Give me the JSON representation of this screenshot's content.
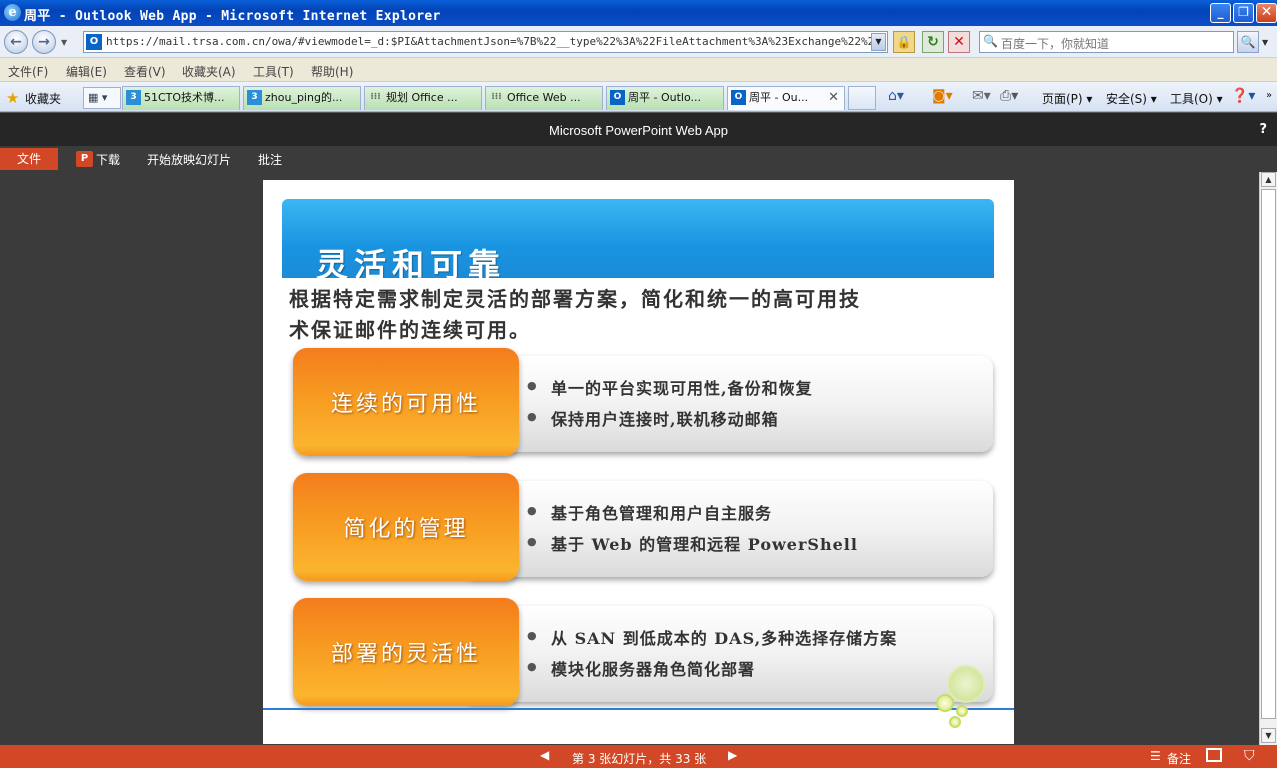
{
  "window": {
    "title": "周平 - Outlook Web App - Microsoft Internet Explorer"
  },
  "address": {
    "url": "https://mail.trsa.com.cn/owa/#viewmodel=_d:$PI&AttachmentJson=%7B%22__type%22%3A%22FileAttachment%3A%23Exchange%22%2C%22Attachm",
    "search_placeholder": "百度一下，你就知道"
  },
  "menu": [
    "文件(F)",
    "编辑(E)",
    "查看(V)",
    "收藏夹(A)",
    "工具(T)",
    "帮助(H)"
  ],
  "favorites_label": "收藏夹",
  "tabs": [
    {
      "label": "51CTO技术博...",
      "icon": "blog-icon"
    },
    {
      "label": "zhou_ping的...",
      "icon": "blog-icon"
    },
    {
      "label": "规划 Office ...",
      "icon": "office-icon"
    },
    {
      "label": "Office Web ...",
      "icon": "office-icon"
    },
    {
      "label": "周平 - Outlo...",
      "icon": "outlook-icon"
    },
    {
      "label": "周平 - Ou...",
      "icon": "outlook-icon"
    }
  ],
  "commands": {
    "page": "页面(P)",
    "safety": "安全(S)",
    "tools": "工具(O)"
  },
  "app": {
    "title": "Microsoft PowerPoint Web App",
    "help": "?"
  },
  "ribbon": {
    "file": "文件",
    "download": "下载",
    "start_slideshow": "开始放映幻灯片",
    "comments": "批注"
  },
  "slide": {
    "title": "灵活和可靠",
    "subtitle_line1": "根据特定需求制定灵活的部署方案，简化和统一的高可用技",
    "subtitle_line2": "术保证邮件的连续可用。",
    "rows": [
      {
        "label": "连续的可用性",
        "bullets": [
          "单一的平台实现可用性,备份和恢复",
          "保持用户连接时,联机移动邮箱"
        ]
      },
      {
        "label": "简化的管理",
        "bullets": [
          "基于角色管理和用户自主服务",
          "基于 Web 的管理和远程 PowerShell"
        ]
      },
      {
        "label": "部署的灵活性",
        "bullets": [
          "从 SAN 到低成本的 DAS,多种选择存储方案",
          "模块化服务器角色简化部署"
        ]
      }
    ]
  },
  "status": {
    "counter": "第 3 张幻灯片，共 33 张",
    "notes": "备注"
  },
  "colors": {
    "accent": "#d24726",
    "banner": "#1a94e0",
    "orange": "#f79b21"
  }
}
